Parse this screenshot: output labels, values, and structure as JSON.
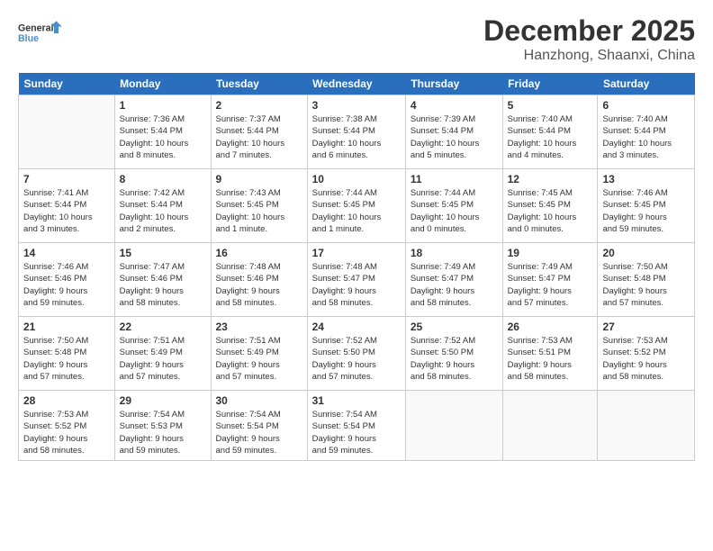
{
  "header": {
    "logo_line1": "General",
    "logo_line2": "Blue",
    "month": "December 2025",
    "location": "Hanzhong, Shaanxi, China"
  },
  "weekdays": [
    "Sunday",
    "Monday",
    "Tuesday",
    "Wednesday",
    "Thursday",
    "Friday",
    "Saturday"
  ],
  "weeks": [
    [
      {
        "day": "",
        "info": ""
      },
      {
        "day": "1",
        "info": "Sunrise: 7:36 AM\nSunset: 5:44 PM\nDaylight: 10 hours\nand 8 minutes."
      },
      {
        "day": "2",
        "info": "Sunrise: 7:37 AM\nSunset: 5:44 PM\nDaylight: 10 hours\nand 7 minutes."
      },
      {
        "day": "3",
        "info": "Sunrise: 7:38 AM\nSunset: 5:44 PM\nDaylight: 10 hours\nand 6 minutes."
      },
      {
        "day": "4",
        "info": "Sunrise: 7:39 AM\nSunset: 5:44 PM\nDaylight: 10 hours\nand 5 minutes."
      },
      {
        "day": "5",
        "info": "Sunrise: 7:40 AM\nSunset: 5:44 PM\nDaylight: 10 hours\nand 4 minutes."
      },
      {
        "day": "6",
        "info": "Sunrise: 7:40 AM\nSunset: 5:44 PM\nDaylight: 10 hours\nand 3 minutes."
      }
    ],
    [
      {
        "day": "7",
        "info": "Sunrise: 7:41 AM\nSunset: 5:44 PM\nDaylight: 10 hours\nand 3 minutes."
      },
      {
        "day": "8",
        "info": "Sunrise: 7:42 AM\nSunset: 5:44 PM\nDaylight: 10 hours\nand 2 minutes."
      },
      {
        "day": "9",
        "info": "Sunrise: 7:43 AM\nSunset: 5:45 PM\nDaylight: 10 hours\nand 1 minute."
      },
      {
        "day": "10",
        "info": "Sunrise: 7:44 AM\nSunset: 5:45 PM\nDaylight: 10 hours\nand 1 minute."
      },
      {
        "day": "11",
        "info": "Sunrise: 7:44 AM\nSunset: 5:45 PM\nDaylight: 10 hours\nand 0 minutes."
      },
      {
        "day": "12",
        "info": "Sunrise: 7:45 AM\nSunset: 5:45 PM\nDaylight: 10 hours\nand 0 minutes."
      },
      {
        "day": "13",
        "info": "Sunrise: 7:46 AM\nSunset: 5:45 PM\nDaylight: 9 hours\nand 59 minutes."
      }
    ],
    [
      {
        "day": "14",
        "info": "Sunrise: 7:46 AM\nSunset: 5:46 PM\nDaylight: 9 hours\nand 59 minutes."
      },
      {
        "day": "15",
        "info": "Sunrise: 7:47 AM\nSunset: 5:46 PM\nDaylight: 9 hours\nand 58 minutes."
      },
      {
        "day": "16",
        "info": "Sunrise: 7:48 AM\nSunset: 5:46 PM\nDaylight: 9 hours\nand 58 minutes."
      },
      {
        "day": "17",
        "info": "Sunrise: 7:48 AM\nSunset: 5:47 PM\nDaylight: 9 hours\nand 58 minutes."
      },
      {
        "day": "18",
        "info": "Sunrise: 7:49 AM\nSunset: 5:47 PM\nDaylight: 9 hours\nand 58 minutes."
      },
      {
        "day": "19",
        "info": "Sunrise: 7:49 AM\nSunset: 5:47 PM\nDaylight: 9 hours\nand 57 minutes."
      },
      {
        "day": "20",
        "info": "Sunrise: 7:50 AM\nSunset: 5:48 PM\nDaylight: 9 hours\nand 57 minutes."
      }
    ],
    [
      {
        "day": "21",
        "info": "Sunrise: 7:50 AM\nSunset: 5:48 PM\nDaylight: 9 hours\nand 57 minutes."
      },
      {
        "day": "22",
        "info": "Sunrise: 7:51 AM\nSunset: 5:49 PM\nDaylight: 9 hours\nand 57 minutes."
      },
      {
        "day": "23",
        "info": "Sunrise: 7:51 AM\nSunset: 5:49 PM\nDaylight: 9 hours\nand 57 minutes."
      },
      {
        "day": "24",
        "info": "Sunrise: 7:52 AM\nSunset: 5:50 PM\nDaylight: 9 hours\nand 57 minutes."
      },
      {
        "day": "25",
        "info": "Sunrise: 7:52 AM\nSunset: 5:50 PM\nDaylight: 9 hours\nand 58 minutes."
      },
      {
        "day": "26",
        "info": "Sunrise: 7:53 AM\nSunset: 5:51 PM\nDaylight: 9 hours\nand 58 minutes."
      },
      {
        "day": "27",
        "info": "Sunrise: 7:53 AM\nSunset: 5:52 PM\nDaylight: 9 hours\nand 58 minutes."
      }
    ],
    [
      {
        "day": "28",
        "info": "Sunrise: 7:53 AM\nSunset: 5:52 PM\nDaylight: 9 hours\nand 58 minutes."
      },
      {
        "day": "29",
        "info": "Sunrise: 7:54 AM\nSunset: 5:53 PM\nDaylight: 9 hours\nand 59 minutes."
      },
      {
        "day": "30",
        "info": "Sunrise: 7:54 AM\nSunset: 5:54 PM\nDaylight: 9 hours\nand 59 minutes."
      },
      {
        "day": "31",
        "info": "Sunrise: 7:54 AM\nSunset: 5:54 PM\nDaylight: 9 hours\nand 59 minutes."
      },
      {
        "day": "",
        "info": ""
      },
      {
        "day": "",
        "info": ""
      },
      {
        "day": "",
        "info": ""
      }
    ]
  ]
}
